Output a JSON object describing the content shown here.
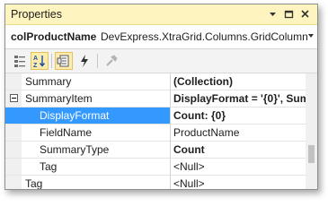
{
  "window": {
    "title": "Properties"
  },
  "title_buttons": [
    {
      "name": "pin-dropdown-icon"
    },
    {
      "name": "restore-icon"
    },
    {
      "name": "close-icon"
    }
  ],
  "object": {
    "name": "colProductName",
    "type": "DevExpress.XtraGrid.Columns.GridColumn"
  },
  "toolbar": {
    "buttons": [
      {
        "name": "categorized-icon",
        "active": false
      },
      {
        "name": "alphabetical-icon",
        "active": true
      },
      {
        "name": "properties-icon",
        "active": true
      },
      {
        "name": "events-icon",
        "active": false
      },
      {
        "name": "property-pages-icon",
        "active": false
      }
    ]
  },
  "properties": [
    {
      "label": "Summary",
      "value": "(Collection)",
      "bold": true,
      "indent": 0,
      "expanded": false,
      "selected": false
    },
    {
      "label": "SummaryItem",
      "value": "DisplayFormat = '{0}', Sum",
      "bold": true,
      "indent": 0,
      "expanded": true,
      "selected": false
    },
    {
      "label": "DisplayFormat",
      "value": "Count: {0}",
      "bold": true,
      "indent": 1,
      "expanded": false,
      "selected": true
    },
    {
      "label": "FieldName",
      "value": "ProductName",
      "bold": false,
      "indent": 1,
      "expanded": false,
      "selected": false
    },
    {
      "label": "SummaryType",
      "value": "Count",
      "bold": true,
      "indent": 1,
      "expanded": false,
      "selected": false
    },
    {
      "label": "Tag",
      "value": "<Null>",
      "bold": false,
      "indent": 1,
      "expanded": false,
      "selected": false
    },
    {
      "label": "Tag",
      "value": "<Null>",
      "bold": false,
      "indent": 0,
      "expanded": false,
      "selected": false
    }
  ],
  "colors": {
    "title_bg": "#fdf4bf",
    "selection": "#3399ff",
    "toolbar_active": "#fcecae"
  }
}
